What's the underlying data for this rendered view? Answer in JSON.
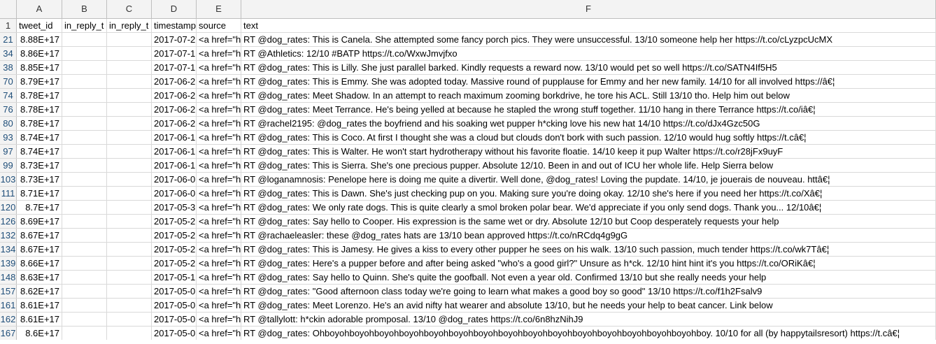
{
  "columns": [
    "A",
    "B",
    "C",
    "D",
    "E",
    "F"
  ],
  "header_row": {
    "num": "1",
    "cells": [
      "tweet_id",
      "in_reply_t",
      "in_reply_t",
      "timestamp",
      "source",
      "text"
    ]
  },
  "rows": [
    {
      "num": "21",
      "a": "8.88E+17",
      "d": "2017-07-2",
      "e": "<a href=\"h",
      "f": "RT @dog_rates: This is Canela. She attempted some fancy porch pics. They were unsuccessful. 13/10 someone help her https://t.co/cLyzpcUcMX"
    },
    {
      "num": "34",
      "a": "8.86E+17",
      "d": "2017-07-1",
      "e": "<a href=\"h",
      "f": "RT @Athletics: 12/10 #BATP https://t.co/WxwJmvjfxo"
    },
    {
      "num": "38",
      "a": "8.85E+17",
      "d": "2017-07-1",
      "e": "<a href=\"h",
      "f": "RT @dog_rates: This is Lilly. She just parallel barked. Kindly requests a reward now. 13/10 would pet so well https://t.co/SATN4If5H5"
    },
    {
      "num": "70",
      "a": "8.79E+17",
      "d": "2017-06-2",
      "e": "<a href=\"h",
      "f": "RT @dog_rates: This is Emmy. She was adopted today. Massive round of pupplause for Emmy and her new family. 14/10 for all involved https://â€¦"
    },
    {
      "num": "74",
      "a": "8.78E+17",
      "d": "2017-06-2",
      "e": "<a href=\"h",
      "f": "RT @dog_rates: Meet Shadow. In an attempt to reach maximum zooming borkdrive, he tore his ACL. Still 13/10 tho. Help him out below"
    },
    {
      "num": "76",
      "a": "8.78E+17",
      "d": "2017-06-2",
      "e": "<a href=\"h",
      "f": "RT @dog_rates: Meet Terrance. He's being yelled at because he stapled the wrong stuff together. 11/10 hang in there Terrance https://t.co/iâ€¦"
    },
    {
      "num": "80",
      "a": "8.78E+17",
      "d": "2017-06-2",
      "e": "<a href=\"h",
      "f": "RT @rachel2195: @dog_rates the boyfriend and his soaking wet pupper h*cking love his new hat 14/10 https://t.co/dJx4Gzc50G"
    },
    {
      "num": "93",
      "a": "8.74E+17",
      "d": "2017-06-1",
      "e": "<a href=\"h",
      "f": "RT @dog_rates: This is Coco. At first I thought she was a cloud but clouds don't bork with such passion. 12/10 would hug softly https://t.câ€¦"
    },
    {
      "num": "97",
      "a": "8.74E+17",
      "d": "2017-06-1",
      "e": "<a href=\"h",
      "f": "RT @dog_rates: This is Walter. He won't start hydrotherapy without his favorite floatie. 14/10 keep it pup Walter https://t.co/r28jFx9uyF"
    },
    {
      "num": "99",
      "a": "8.73E+17",
      "d": "2017-06-1",
      "e": "<a href=\"h",
      "f": "RT @dog_rates: This is Sierra. She's one precious pupper. Absolute 12/10. Been in and out of ICU her whole life. Help Sierra below"
    },
    {
      "num": "103",
      "a": "8.73E+17",
      "d": "2017-06-0",
      "e": "<a href=\"h",
      "f": "RT @loganamnosis: Penelope here is doing me quite a divertir. Well done, @dog_rates! Loving the pupdate. 14/10, je jouerais de nouveau. httâ€¦"
    },
    {
      "num": "111",
      "a": "8.71E+17",
      "d": "2017-06-0",
      "e": "<a href=\"h",
      "f": "RT @dog_rates: This is Dawn. She's just checking pup on you. Making sure you're doing okay. 12/10 she's here if you need her https://t.co/Xâ€¦"
    },
    {
      "num": "120",
      "a": "8.7E+17",
      "d": "2017-05-3",
      "e": "<a href=\"h",
      "f": "RT @dog_rates: We only rate dogs. This is quite clearly a smol broken polar bear. We'd appreciate if you only send dogs. Thank you... 12/10â€¦"
    },
    {
      "num": "126",
      "a": "8.69E+17",
      "d": "2017-05-2",
      "e": "<a href=\"h",
      "f": "RT @dog_rates: Say hello to Cooper. His expression is the same wet or dry. Absolute 12/10 but Coop desperately requests your help"
    },
    {
      "num": "132",
      "a": "8.67E+17",
      "d": "2017-05-2",
      "e": "<a href=\"h",
      "f": "RT @rachaeleasler: these @dog_rates hats are 13/10 bean approved https://t.co/nRCdq4g9gG"
    },
    {
      "num": "134",
      "a": "8.67E+17",
      "d": "2017-05-2",
      "e": "<a href=\"h",
      "f": "RT @dog_rates: This is Jamesy. He gives a kiss to every other pupper he sees on his walk. 13/10 such passion, much tender https://t.co/wk7Tâ€¦"
    },
    {
      "num": "139",
      "a": "8.66E+17",
      "d": "2017-05-2",
      "e": "<a href=\"h",
      "f": "RT @dog_rates: Here's a pupper before and after being asked \"who's a good girl?\" Unsure as h*ck. 12/10 hint hint it's you https://t.co/ORiKâ€¦"
    },
    {
      "num": "148",
      "a": "8.63E+17",
      "d": "2017-05-1",
      "e": "<a href=\"h",
      "f": "RT @dog_rates: Say hello to Quinn. She's quite the goofball. Not even a year old. Confirmed 13/10 but she really needs your help"
    },
    {
      "num": "157",
      "a": "8.62E+17",
      "d": "2017-05-0",
      "e": "<a href=\"h",
      "f": "RT @dog_rates: \"Good afternoon class today we're going to learn what makes a good boy so good\" 13/10 https://t.co/f1h2Fsalv9"
    },
    {
      "num": "161",
      "a": "8.61E+17",
      "d": "2017-05-0",
      "e": "<a href=\"h",
      "f": "RT @dog_rates: Meet Lorenzo. He's an avid nifty hat wearer and absolute 13/10, but he needs your help to beat cancer. Link below"
    },
    {
      "num": "162",
      "a": "8.61E+17",
      "d": "2017-05-0",
      "e": "<a href=\"h",
      "f": "RT @tallylott: h*ckin adorable promposal. 13/10 @dog_rates https://t.co/6n8hzNihJ9"
    },
    {
      "num": "167",
      "a": "8.6E+17",
      "d": "2017-05-0",
      "e": "<a href=\"h",
      "f": "RT @dog_rates: Ohboyohboyohboyohboyohboyohboyohboyohboyohboyohboyohboyohboyohboyohboyohboyohboy. 10/10 for all (by happytailsresort) https://t.câ€¦"
    }
  ]
}
